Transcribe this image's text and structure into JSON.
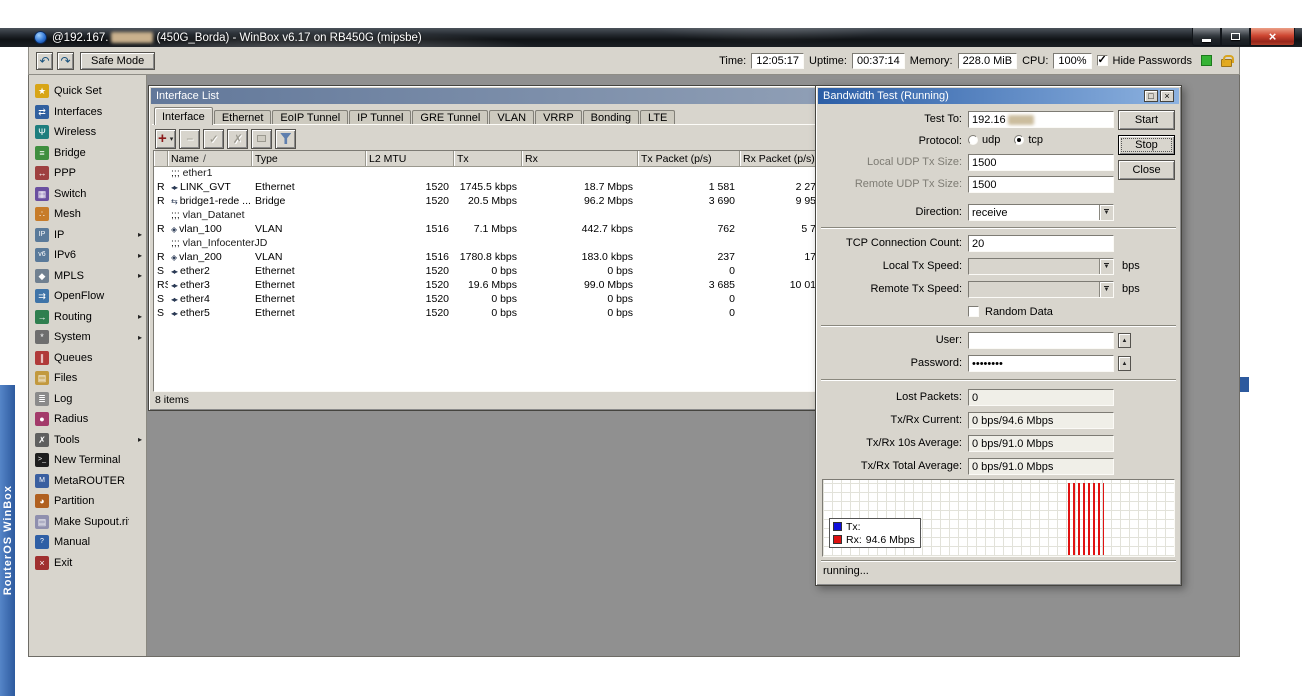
{
  "window": {
    "title_user": "@192.167.",
    "title_rest": "(450G_Borda) - WinBox v6.17 on RB450G (mipsbe)"
  },
  "toolbar": {
    "safe_mode_label": "Safe Mode",
    "stats": [
      {
        "label": "Time:",
        "value": "12:05:17"
      },
      {
        "label": "Uptime:",
        "value": "00:37:14"
      },
      {
        "label": "Memory:",
        "value": "228.0 MiB"
      },
      {
        "label": "CPU:",
        "value": "100%"
      }
    ],
    "hide_passwords_label": "Hide Passwords",
    "hide_passwords_checked": true
  },
  "sidebar": {
    "vertical_text": "RouterOS WinBox",
    "items": [
      {
        "label": "Quick Set",
        "icon": "quickset-icon",
        "submenu": false
      },
      {
        "label": "Interfaces",
        "icon": "interfaces-icon",
        "submenu": false
      },
      {
        "label": "Wireless",
        "icon": "wireless-icon",
        "submenu": false
      },
      {
        "label": "Bridge",
        "icon": "bridge-icon",
        "submenu": false
      },
      {
        "label": "PPP",
        "icon": "ppp-icon",
        "submenu": false
      },
      {
        "label": "Switch",
        "icon": "switch-icon",
        "submenu": false
      },
      {
        "label": "Mesh",
        "icon": "mesh-icon",
        "submenu": false
      },
      {
        "label": "IP",
        "icon": "ip-icon",
        "submenu": true
      },
      {
        "label": "IPv6",
        "icon": "ipv6-icon",
        "submenu": true
      },
      {
        "label": "MPLS",
        "icon": "mpls-icon",
        "submenu": true
      },
      {
        "label": "OpenFlow",
        "icon": "openflow-icon",
        "submenu": false
      },
      {
        "label": "Routing",
        "icon": "routing-icon",
        "submenu": true
      },
      {
        "label": "System",
        "icon": "system-icon",
        "submenu": true
      },
      {
        "label": "Queues",
        "icon": "queues-icon",
        "submenu": false
      },
      {
        "label": "Files",
        "icon": "files-icon",
        "submenu": false
      },
      {
        "label": "Log",
        "icon": "log-icon",
        "submenu": false
      },
      {
        "label": "Radius",
        "icon": "radius-icon",
        "submenu": false
      },
      {
        "label": "Tools",
        "icon": "tools-icon",
        "submenu": true
      },
      {
        "label": "New Terminal",
        "icon": "terminal-icon",
        "submenu": false
      },
      {
        "label": "MetaROUTER",
        "icon": "metarouter-icon",
        "submenu": false
      },
      {
        "label": "Partition",
        "icon": "partition-icon",
        "submenu": false
      },
      {
        "label": "Make Supout.rif",
        "icon": "supout-icon",
        "submenu": false
      },
      {
        "label": "Manual",
        "icon": "manual-icon",
        "submenu": false
      },
      {
        "label": "Exit",
        "icon": "exit-icon",
        "submenu": false
      }
    ]
  },
  "interface_list": {
    "title": "Interface List",
    "tabs": [
      "Interface",
      "Ethernet",
      "EoIP Tunnel",
      "IP Tunnel",
      "GRE Tunnel",
      "VLAN",
      "VRRP",
      "Bonding",
      "LTE"
    ],
    "active_tab": 0,
    "sort_indicator": "/",
    "columns": [
      "Name",
      "Type",
      "L2 MTU",
      "Tx",
      "Rx",
      "Tx Packet (p/s)",
      "Rx Packet (p/s)"
    ],
    "rows": [
      {
        "kind": "comment",
        "text": ";;; ether1"
      },
      {
        "kind": "interface",
        "flags": "R",
        "icon": "ethernet-interface-icon",
        "name": "LINK_GVT",
        "type": "Ethernet",
        "l2mtu": "1520",
        "tx": "1745.5 kbps",
        "rx": "18.7 Mbps",
        "tx_packet": "1 581",
        "rx_packet": "2 27"
      },
      {
        "kind": "interface",
        "flags": "R",
        "icon": "bridge-interface-icon",
        "name": "bridge1-rede ...",
        "type": "Bridge",
        "l2mtu": "1520",
        "tx": "20.5 Mbps",
        "rx": "96.2 Mbps",
        "tx_packet": "3 690",
        "rx_packet": "9 95"
      },
      {
        "kind": "comment",
        "text": ";;; vlan_Datanet"
      },
      {
        "kind": "interface",
        "flags": "R",
        "icon": "vlan-interface-icon",
        "name": "vlan_100",
        "type": "VLAN",
        "l2mtu": "1516",
        "tx": "7.1 Mbps",
        "rx": "442.7 kbps",
        "tx_packet": "762",
        "rx_packet": "5 7"
      },
      {
        "kind": "comment",
        "text": ";;; vlan_InfocenterJD"
      },
      {
        "kind": "interface",
        "flags": "R",
        "icon": "vlan-interface-icon",
        "name": "vlan_200",
        "type": "VLAN",
        "l2mtu": "1516",
        "tx": "1780.8 kbps",
        "rx": "183.0 kbps",
        "tx_packet": "237",
        "rx_packet": "17"
      },
      {
        "kind": "interface",
        "flags": "S",
        "icon": "ethernet-interface-icon",
        "name": "ether2",
        "type": "Ethernet",
        "l2mtu": "1520",
        "tx": "0 bps",
        "rx": "0 bps",
        "tx_packet": "0",
        "rx_packet": ""
      },
      {
        "kind": "interface",
        "flags": "RS",
        "icon": "ethernet-interface-icon",
        "name": "ether3",
        "type": "Ethernet",
        "l2mtu": "1520",
        "tx": "19.6 Mbps",
        "rx": "99.0 Mbps",
        "tx_packet": "3 685",
        "rx_packet": "10 01"
      },
      {
        "kind": "interface",
        "flags": "S",
        "icon": "ethernet-interface-icon",
        "name": "ether4",
        "type": "Ethernet",
        "l2mtu": "1520",
        "tx": "0 bps",
        "rx": "0 bps",
        "tx_packet": "0",
        "rx_packet": ""
      },
      {
        "kind": "interface",
        "flags": "S",
        "icon": "ethernet-interface-icon",
        "name": "ether5",
        "type": "Ethernet",
        "l2mtu": "1520",
        "tx": "0 bps",
        "rx": "0 bps",
        "tx_packet": "0",
        "rx_packet": ""
      }
    ],
    "status": "8 items"
  },
  "bandwidth_test": {
    "title": "Bandwidth Test (Running)",
    "buttons": {
      "start": "Start",
      "stop": "Stop",
      "close": "Close"
    },
    "status": "running...",
    "test_to": {
      "label": "Test To:",
      "value": "192.16"
    },
    "protocol": {
      "label": "Protocol:",
      "options": [
        "udp",
        "tcp"
      ],
      "selected": "tcp"
    },
    "local_udp_tx_size": {
      "label": "Local UDP Tx Size:",
      "value": "1500"
    },
    "remote_udp_tx_size": {
      "label": "Remote UDP Tx Size:",
      "value": "1500"
    },
    "direction": {
      "label": "Direction:",
      "value": "receive"
    },
    "tcp_connection_count": {
      "label": "TCP Connection Count:",
      "value": "20"
    },
    "local_tx_speed": {
      "label": "Local Tx Speed:",
      "value": "",
      "unit": "bps"
    },
    "remote_tx_speed": {
      "label": "Remote Tx Speed:",
      "value": "",
      "unit": "bps"
    },
    "random_data": {
      "label": "Random Data",
      "checked": false
    },
    "user": {
      "label": "User:",
      "value": ""
    },
    "password": {
      "label": "Password:",
      "value": "••••••••"
    },
    "lost_packets": {
      "label": "Lost Packets:",
      "value": "0"
    },
    "txrx_current": {
      "label": "Tx/Rx Current:",
      "value": "0 bps/94.6 Mbps"
    },
    "txrx_10s_average": {
      "label": "Tx/Rx 10s Average:",
      "value": "0 bps/91.0 Mbps"
    },
    "txrx_total_average": {
      "label": "Tx/Rx Total Average:",
      "value": "0 bps/91.0 Mbps"
    },
    "graph": {
      "legend": [
        {
          "name": "Tx:",
          "value": "",
          "color": "#1010dd"
        },
        {
          "name": "Rx:",
          "value": "94.6 Mbps",
          "color": "#dd1010"
        }
      ],
      "bars_color": "#e01212"
    }
  }
}
